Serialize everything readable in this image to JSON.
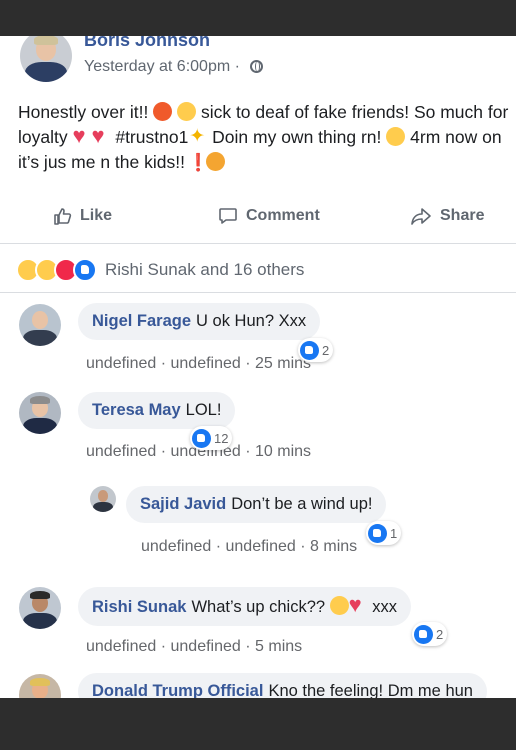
{
  "post": {
    "author": "Boris Johnson",
    "timestamp": "Yesterday at 6:00pm · ",
    "text_parts": {
      "p1": "Honestly over it!! ",
      "p2": " sick to deaf of fake friends! So much for loyalty ",
      "p3": " #trustno1",
      "p4": " Doin my own thing rn! ",
      "p5": " 4rm now on it’s jus me n the kids!! "
    }
  },
  "actions": {
    "like": "Like",
    "comment": "Comment",
    "share": "Share"
  },
  "reactions_summary": "Rishi Sunak and 16 others",
  "comments": [
    {
      "name": "Nigel Farage",
      "text": "U ok Hun? Xxx",
      "meta": "undefined · undefined · 25 mins",
      "likes": "2"
    },
    {
      "name": "Teresa May",
      "text": "LOL!",
      "meta": "undefined · undefined · 10 mins",
      "likes": "12"
    },
    {
      "name": "Sajid Javid",
      "text": "Don’t be a wind up!",
      "meta": "undefined · undefined · 8 mins",
      "likes": "1"
    },
    {
      "name": "Rishi Sunak",
      "text": "What’s up chick?? ",
      "text_end": " xxx",
      "meta": "undefined · undefined · 5 mins",
      "likes": "2"
    },
    {
      "name": "Donald Trump Official",
      "text": "Kno the feeling! Dm me hun"
    }
  ],
  "colors": {
    "link_blue": "#385898",
    "like_blue": "#1877f2",
    "meta_grey": "#65676b",
    "bubble_bg": "#f0f2f5"
  }
}
